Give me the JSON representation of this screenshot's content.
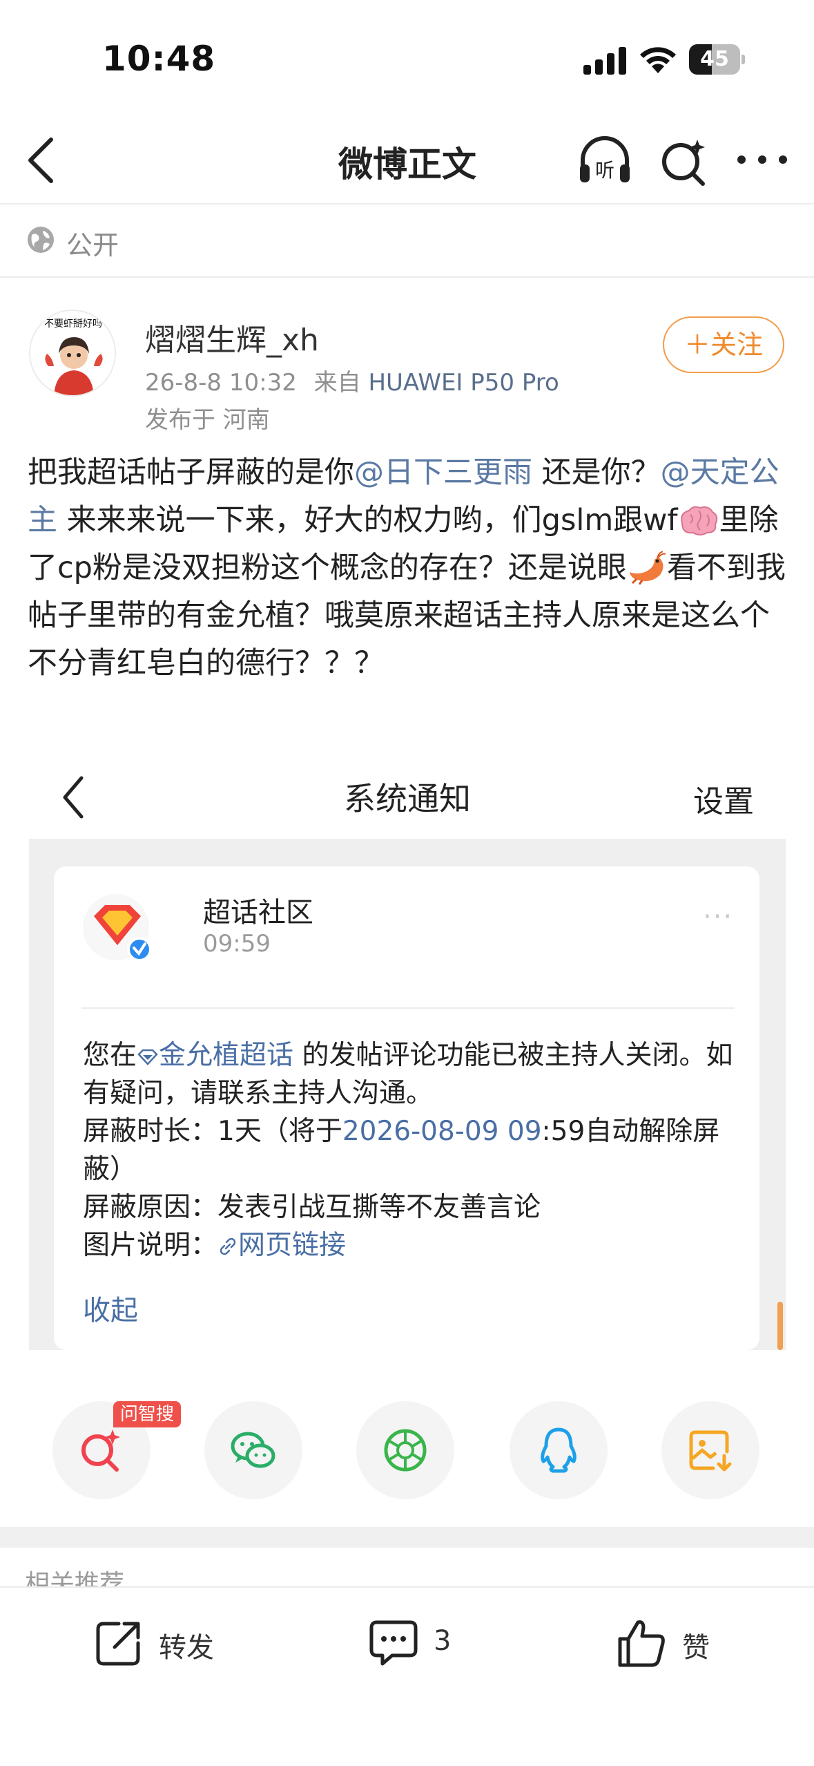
{
  "status_bar": {
    "time": "10:48",
    "battery": "45",
    "battery_level": 0.45
  },
  "nav": {
    "title": "微博正文",
    "back_icon": "chevron-left-icon",
    "listen_icon": "headphones-listen-icon",
    "listen_glyph": "听",
    "search_icon": "search-sparkle-icon",
    "more_icon": "more-dots-icon"
  },
  "visibility": {
    "icon": "globe-icon",
    "label": "公开"
  },
  "author": {
    "avatar_caption": "不要虾掰好吗",
    "name": "熠熠生辉_xh",
    "date": "26-8-8 10:32",
    "source_prefix": "来自",
    "device": "HUAWEI P50 Pro",
    "location": "发布于 河南",
    "follow_label": "＋关注"
  },
  "post": {
    "t1": "把我超话帖子屏蔽的是你",
    "mention1": "@日下三更雨",
    "t2": "还是你？",
    "mention2": "@天定公主",
    "t3": "来来来说一下来，好大的权力哟，们gslm跟wf",
    "t4": "里除了cp粉是没双担粉这个概念的存在？还是说眼",
    "t5": "看不到我帖子里带的有金允植？哦莫原来超话主持人原来是这么个不分青红皂白的德行？？？",
    "emoji1": "brain-emoji",
    "emoji2": "shrimp-emoji"
  },
  "embedded": {
    "header_title": "系统通知",
    "settings_label": "设置",
    "card": {
      "sender": "超话社区",
      "time": "09:59",
      "more": "···",
      "line1_a": "您在",
      "topic": "金允植超话",
      "line1_b": "的发帖评论功能已被主持人关闭。如有疑问，请联系主持人沟通。",
      "duration_label": "屏蔽时长：",
      "duration_value_a": "1天（将于",
      "duration_date": "2026-08-09 09",
      "duration_value_b": ":59自动解除屏蔽）",
      "reason_label": "屏蔽原因：",
      "reason_value": "发表引战互撕等不友善言论",
      "image_label": "图片说明：",
      "link_label": "网页链接",
      "collapse_label": "收起"
    }
  },
  "share": {
    "badge": "问智搜",
    "items": [
      {
        "icon": "ai-search-icon"
      },
      {
        "icon": "wechat-icon",
        "color": "#2aae67"
      },
      {
        "icon": "moments-icon",
        "color": "#39b54a"
      },
      {
        "icon": "qq-icon",
        "color": "#1ea0e8"
      },
      {
        "icon": "save-image-icon",
        "color": "#f5a623"
      }
    ]
  },
  "related_label": "相关推荐",
  "bottom_bar": {
    "repost_label": "转发",
    "comment_count": "3",
    "like_label": "赞"
  },
  "colors": {
    "accent_orange": "#f08a2c",
    "link_blue": "#5a79a3",
    "badge_red": "#f0504a"
  }
}
